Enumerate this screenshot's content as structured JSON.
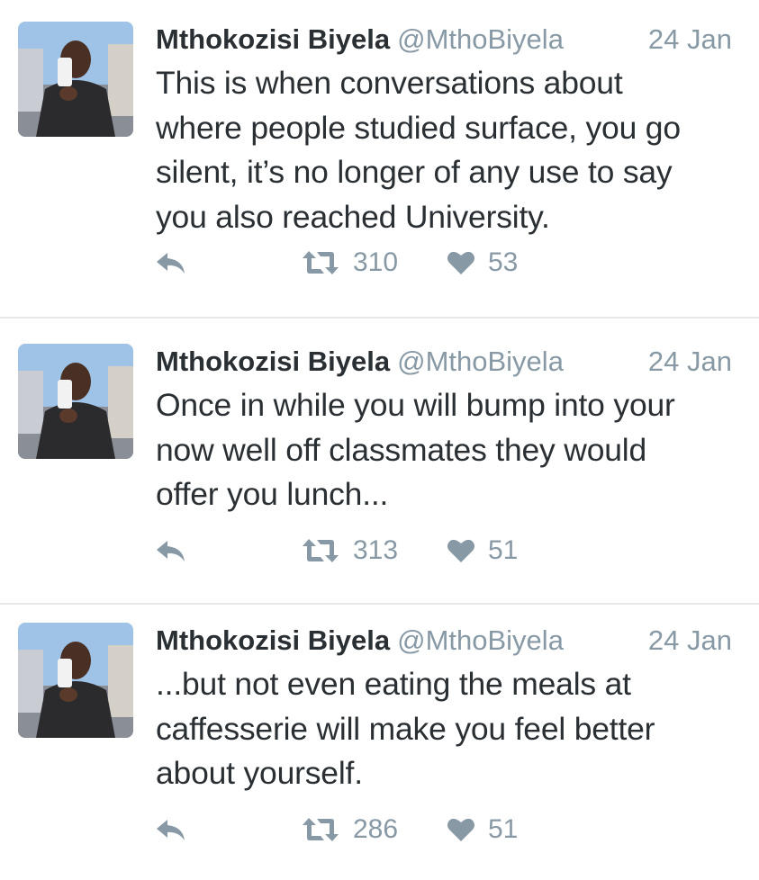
{
  "colors": {
    "text": "#292f33",
    "muted": "#8899a6",
    "divider": "#e6e8ea"
  },
  "tweets": [
    {
      "name": "Mthokozisi Biyela",
      "handle": "@MthoBiyela",
      "date": "24 Jan",
      "text": "This is when conversations about\nwhere people studied surface, you go\nsilent, it’s no longer of any use to say\nyou also reached University.",
      "retweets": "310",
      "likes": "53",
      "icons": [
        "reply-icon",
        "retweet-icon",
        "heart-icon"
      ]
    },
    {
      "name": "Mthokozisi Biyela",
      "handle": "@MthoBiyela",
      "date": "24 Jan",
      "text": "Once in while you will bump into your\nnow well off classmates they would\noffer you lunch...",
      "retweets": "313",
      "likes": "51",
      "icons": [
        "reply-icon",
        "retweet-icon",
        "heart-icon"
      ]
    },
    {
      "name": "Mthokozisi Biyela",
      "handle": "@MthoBiyela",
      "date": "24 Jan",
      "text": "...but not even eating the meals at\ncaffesserie will make you feel better\nabout yourself.",
      "retweets": "286",
      "likes": "51",
      "icons": [
        "reply-icon",
        "retweet-icon",
        "heart-icon"
      ]
    }
  ]
}
